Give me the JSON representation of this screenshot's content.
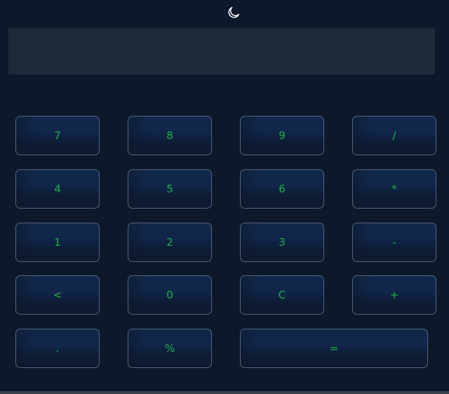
{
  "header": {
    "theme_toggle_icon": "crescent-moon-icon"
  },
  "display": {
    "value": ""
  },
  "keypad": {
    "rows": [
      [
        "7",
        "8",
        "9",
        "/"
      ],
      [
        "4",
        "5",
        "6",
        "*"
      ],
      [
        "1",
        "2",
        "3",
        "-"
      ],
      [
        "<",
        "0",
        "C",
        "+"
      ],
      [
        ".",
        "%",
        "="
      ]
    ]
  },
  "colors": {
    "background": "#0e182b",
    "display_background": "#1e2a3a",
    "key_text": "#1fb04a",
    "key_border": "#55657c",
    "icon": "#ffffff"
  }
}
